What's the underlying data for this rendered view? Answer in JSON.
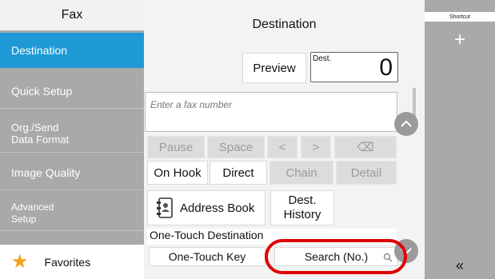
{
  "sidebar": {
    "title": "Fax",
    "items": {
      "destination": "Destination",
      "quick_setup": "Quick Setup",
      "org_send_line1": "Org./Send",
      "org_send_line2": "Data Format",
      "image_quality": "Image Quality",
      "advanced_line1": "Advanced",
      "advanced_line2": "Setup"
    },
    "favorites": "Favorites"
  },
  "main": {
    "title": "Destination",
    "preview": "Preview",
    "dest_label": "Dest.",
    "dest_count": "0",
    "fax_placeholder": "Enter a fax number",
    "row1": {
      "pause": "Pause",
      "space": "Space",
      "left": "<",
      "right": ">",
      "backspace": "⌫"
    },
    "row2": {
      "on_hook": "On Hook",
      "direct": "Direct",
      "chain": "Chain",
      "detail": "Detail"
    },
    "address_book": "Address Book",
    "dest_history_line1": "Dest.",
    "dest_history_line2": "History",
    "one_touch_destination": "One-Touch Destination",
    "one_touch_key": "One-Touch Key",
    "search_no": "Search (No.)"
  },
  "shortcut": {
    "title": "Shortcut",
    "add": "+",
    "collapse": "«"
  },
  "colors": {
    "accent": "#1e9ad6",
    "highlight": "#e00000",
    "sidebar_bg": "#a7a9ab",
    "star": "#f2a31b"
  }
}
